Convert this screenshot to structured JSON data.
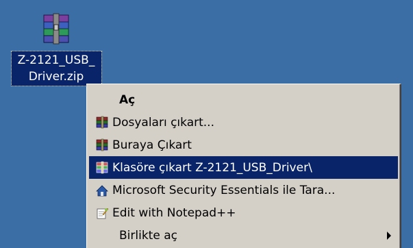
{
  "desktop": {
    "file_icon": "winrar-archive-icon",
    "file_label_line1": "Z-2121_USB_",
    "file_label_line2": "Driver.zip",
    "background_color": "#3a6ea5"
  },
  "context_menu": {
    "items": [
      {
        "label": "Aç",
        "icon": "none"
      },
      {
        "label": "Dosyaları çıkart...",
        "icon": "winrar-books-icon"
      },
      {
        "label": "Buraya Çıkart",
        "icon": "winrar-books-icon"
      },
      {
        "label": "Klasöre çıkart Z-2121_USB_Driver\\",
        "icon": "winrar-books-icon"
      },
      {
        "label": "Microsoft Security Essentials ile Tara...",
        "icon": "security-essentials-icon"
      },
      {
        "label": "Edit with Notepad++",
        "icon": "notepad-plus-plus-icon"
      },
      {
        "label": "Birlikte aç",
        "icon": "none"
      }
    ],
    "highlight_color": "#0a246a",
    "menu_color": "#d4d0c8"
  }
}
